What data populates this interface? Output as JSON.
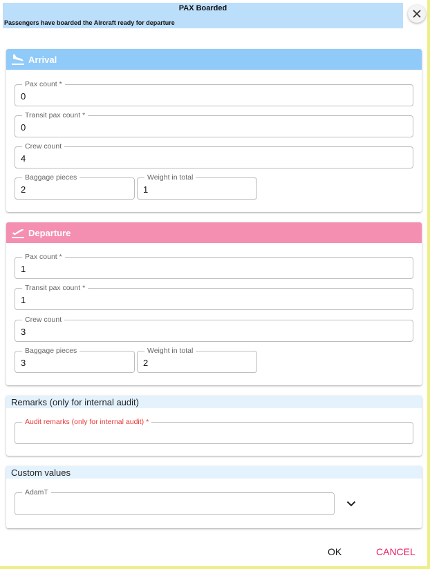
{
  "header": {
    "title": "PAX Boarded",
    "subtitle": "Passengers have boarded the Aircraft ready for departure"
  },
  "arrival": {
    "title": "Arrival",
    "pax_label": "Pax count *",
    "pax_value": "0",
    "transit_label": "Transit pax count *",
    "transit_value": "0",
    "crew_label": "Crew count",
    "crew_value": "4",
    "baggage_label": "Baggage pieces",
    "baggage_value": "2",
    "weight_label": "Weight in total",
    "weight_value": "1"
  },
  "departure": {
    "title": "Departure",
    "pax_label": "Pax count *",
    "pax_value": "1",
    "transit_label": "Transit pax count *",
    "transit_value": "1",
    "crew_label": "Crew count",
    "crew_value": "3",
    "baggage_label": "Baggage pieces",
    "baggage_value": "3",
    "weight_label": "Weight in total",
    "weight_value": "2"
  },
  "remarks": {
    "title": "Remarks (only for internal audit)",
    "field_label": "Audit remarks (only for internal audit) *",
    "field_value": ""
  },
  "custom": {
    "title": "Custom values",
    "field_label": "AdamT",
    "field_value": ""
  },
  "actions": {
    "ok_label": "OK",
    "cancel_label": "CANCEL"
  },
  "colors": {
    "header_bg": "#bbdefb",
    "arrival_accent": "#90caf9",
    "departure_accent": "#f48fb1",
    "cancel_color": "#e91e63",
    "required_red": "#e53935"
  }
}
